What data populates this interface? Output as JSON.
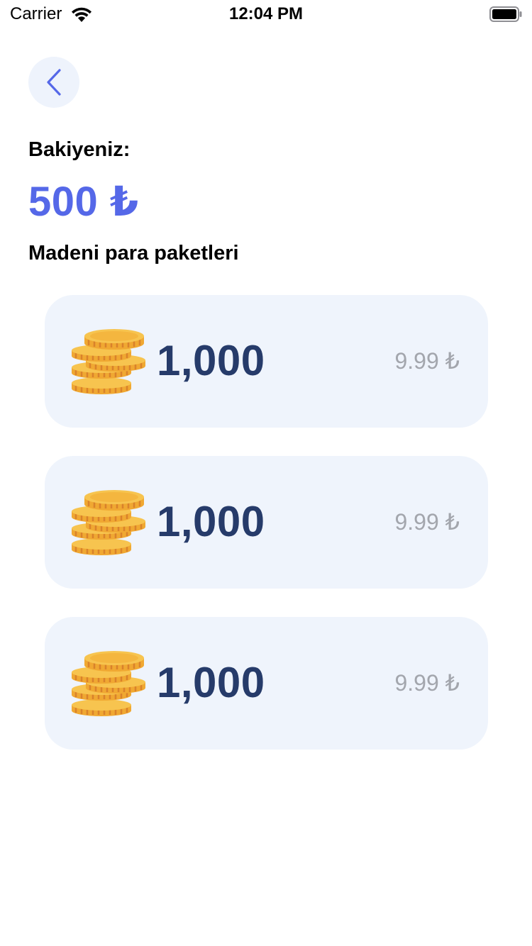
{
  "status_bar": {
    "carrier": "Carrier",
    "time": "12:04 PM"
  },
  "back_icon": "chevron-left-icon",
  "balance": {
    "label": "Bakiyeniz:",
    "value": "500 ₺"
  },
  "section_title": "Madeni para paketleri",
  "packages": [
    {
      "amount": "1,000",
      "price": "9.99 ₺",
      "icon": "coin-stack-icon"
    },
    {
      "amount": "1,000",
      "price": "9.99 ₺",
      "icon": "coin-stack-icon"
    },
    {
      "amount": "1,000",
      "price": "9.99 ₺",
      "icon": "coin-stack-icon"
    }
  ],
  "colors": {
    "accent": "#5568e8",
    "amount_text": "#263b6a",
    "card_background": "#eff4fc",
    "price_text": "#a3a6ad",
    "coin_gold": "#f5c04a"
  }
}
